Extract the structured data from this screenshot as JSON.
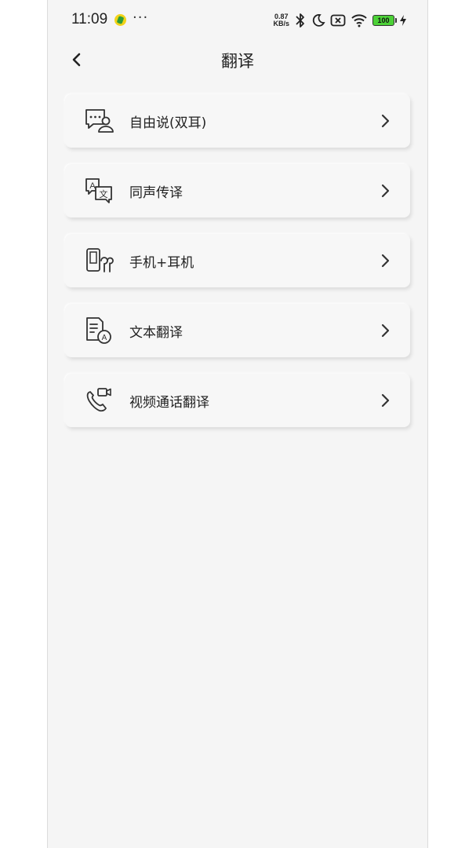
{
  "status_bar": {
    "time": "11:09",
    "dots": "···",
    "net_speed_value": "0.87",
    "net_speed_unit": "KB/s",
    "battery": "100"
  },
  "header": {
    "title": "翻译"
  },
  "menu": {
    "items": [
      {
        "label": "自由说(双耳)",
        "icon": "chat-person-icon"
      },
      {
        "label": "同声传译",
        "icon": "translate-icon"
      },
      {
        "label": "手机+耳机",
        "icon": "phone-earbud-icon"
      },
      {
        "label": "文本翻译",
        "icon": "text-translate-icon"
      },
      {
        "label": "视频通话翻译",
        "icon": "video-call-icon"
      }
    ]
  },
  "colors": {
    "background": "#f5f5f5",
    "text": "#222222",
    "battery": "#4cd137"
  }
}
